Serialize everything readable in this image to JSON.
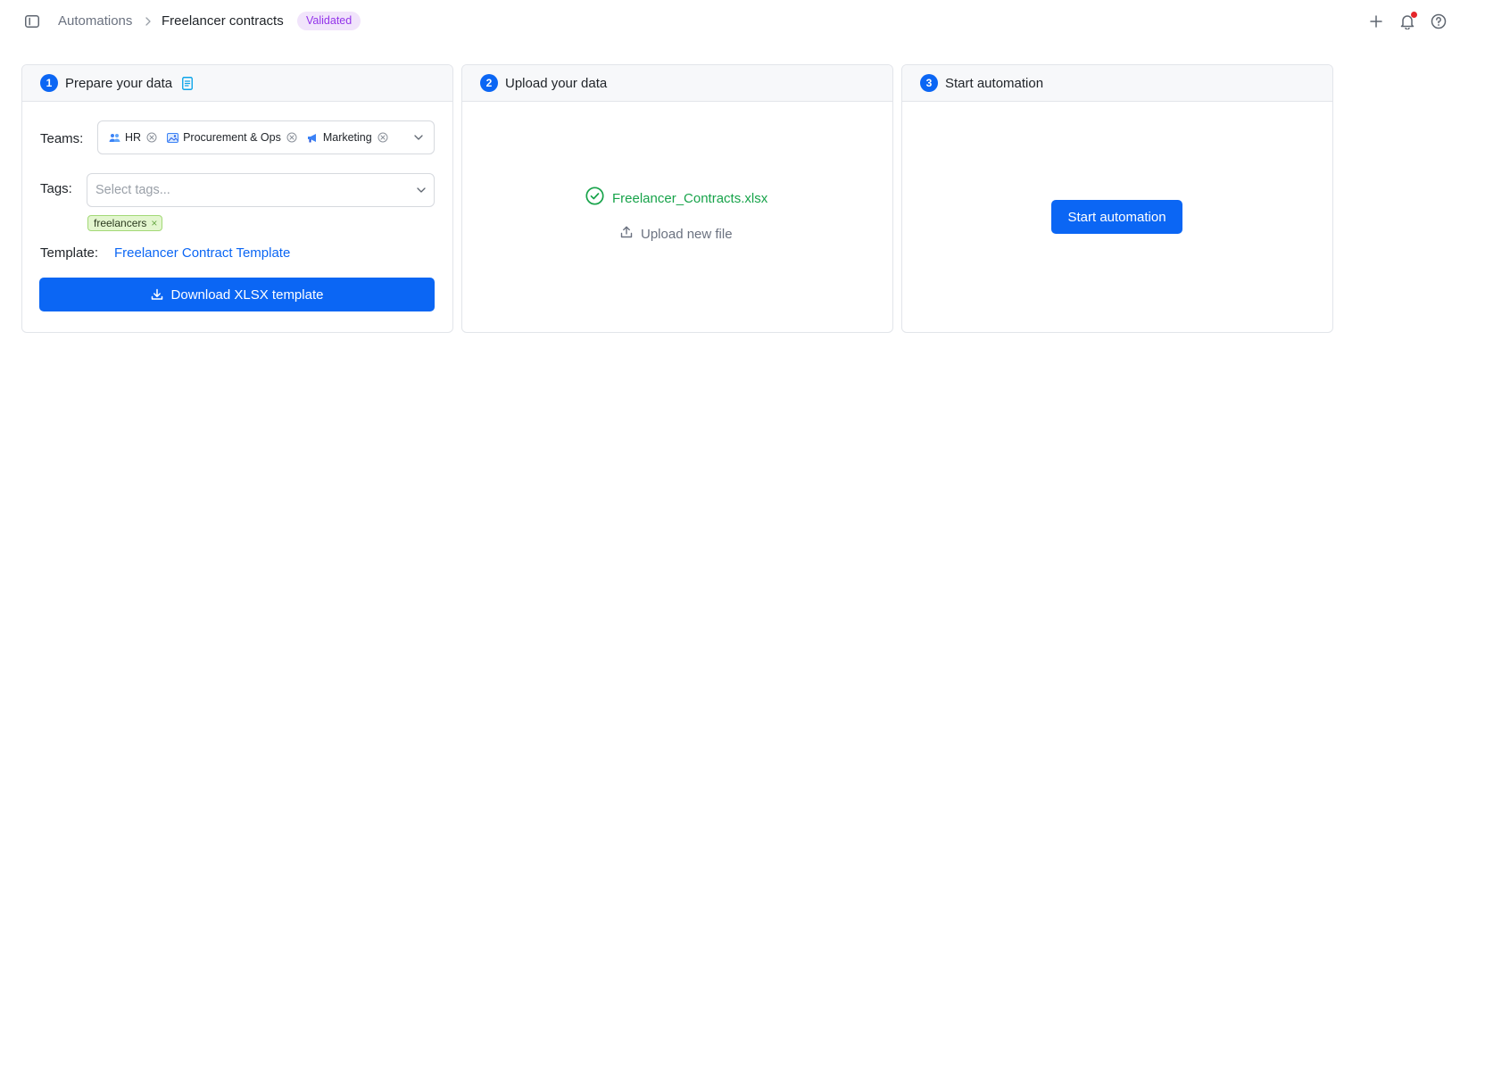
{
  "header": {
    "breadcrumb_root": "Automations",
    "breadcrumb_current": "Freelancer contracts",
    "status_badge": "Validated",
    "icons": [
      "sidebar-toggle-icon",
      "chevron-right-icon",
      "plus-icon",
      "bell-icon",
      "help-icon"
    ]
  },
  "steps": [
    {
      "number": "1",
      "title": "Prepare your data",
      "teams_label": "Teams:",
      "teams": [
        {
          "label": "HR",
          "icon": "people-icon"
        },
        {
          "label": "Procurement & Ops",
          "icon": "picture-icon"
        },
        {
          "label": "Marketing",
          "icon": "megaphone-icon"
        }
      ],
      "tags_label": "Tags:",
      "tags_placeholder": "Select tags...",
      "tags": [
        {
          "label": "freelancers"
        }
      ],
      "template_label": "Template:",
      "template_link": "Freelancer Contract Template",
      "download_button": "Download XLSX template"
    },
    {
      "number": "2",
      "title": "Upload your data",
      "file_name": "Freelancer_Contracts.xlsx",
      "upload_link": "Upload new file"
    },
    {
      "number": "3",
      "title": "Start automation",
      "start_button": "Start automation"
    }
  ],
  "colors": {
    "accent": "#0b66f4",
    "success": "#17a34a",
    "badge_bg": "#f1e4fb",
    "badge_text": "#9333ea",
    "tag_bg": "#e3f6cf",
    "notification_dot": "#e5262b"
  }
}
